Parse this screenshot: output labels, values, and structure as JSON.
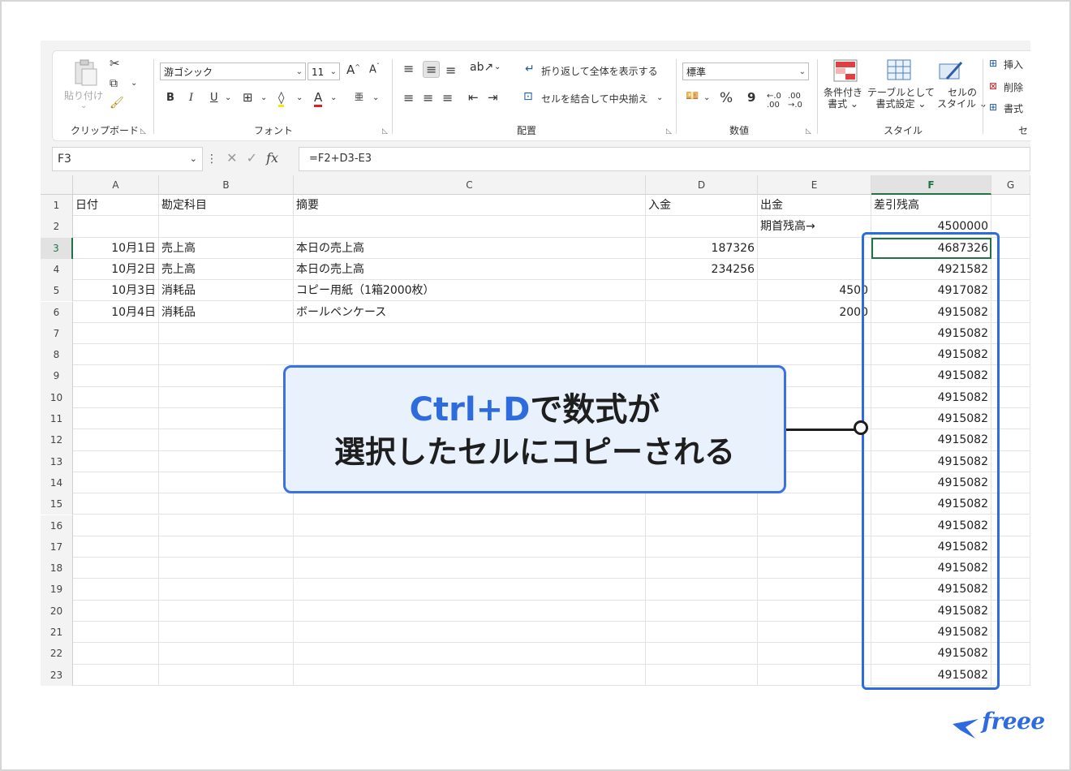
{
  "ribbon": {
    "clipboard": {
      "paste_label": "貼り付け",
      "group_label": "クリップボード"
    },
    "font": {
      "font_name": "游ゴシック",
      "font_size": "11",
      "group_label": "フォント",
      "bold": "B",
      "italic": "I",
      "underline": "U"
    },
    "alignment": {
      "wrap_text": "折り返して全体を表示する",
      "merge_center": "セルを結合して中央揃え",
      "group_label": "配置"
    },
    "number": {
      "format": "標準",
      "percent": "%",
      "comma": "9",
      "group_label": "数値"
    },
    "styles": {
      "conditional": "条件付き\n書式",
      "conditional_l1": "条件付き",
      "conditional_l2": "書式",
      "table_l1": "テーブルとして",
      "table_l2": "書式設定",
      "cell_l1": "セルの",
      "cell_l2": "スタイル",
      "group_label": "スタイル"
    },
    "cells": {
      "insert": "挿入",
      "delete": "削除",
      "format": "書式",
      "group_label": "セ"
    }
  },
  "formula_bar": {
    "name_box": "F3",
    "formula": "=F2+D3-E3",
    "fx": "fx"
  },
  "columns": [
    "A",
    "B",
    "C",
    "D",
    "E",
    "F",
    "G"
  ],
  "rows": [
    "1",
    "2",
    "3",
    "4",
    "5",
    "6",
    "7",
    "8",
    "9",
    "10",
    "11",
    "12",
    "13",
    "14",
    "15",
    "16",
    "17",
    "18",
    "19",
    "20",
    "21",
    "22",
    "23"
  ],
  "cells": {
    "A1": "日付",
    "B1": "勘定科目",
    "C1": "摘要",
    "D1": "入金",
    "E1": "出金",
    "F1": "差引残高",
    "E2": "期首残高→",
    "F2": "4500000",
    "A3": "10月1日",
    "B3": "売上高",
    "C3": "本日の売上高",
    "D3": "187326",
    "F3": "4687326",
    "A4": "10月2日",
    "B4": "売上高",
    "C4": "本日の売上高",
    "D4": "234256",
    "F4": "4921582",
    "A5": "10月3日",
    "B5": "消耗品",
    "C5": "コピー用紙（1箱2000枚）",
    "E5": "4500",
    "F5": "4917082",
    "A6": "10月4日",
    "B6": "消耗品",
    "C6": "ボールペンケース",
    "E6": "2000",
    "F6": "4915082",
    "F7": "4915082",
    "F8": "4915082",
    "F9": "4915082",
    "F10": "4915082",
    "F11": "4915082",
    "F12": "4915082",
    "F13": "4915082",
    "F14": "4915082",
    "F15": "4915082",
    "F16": "4915082",
    "F17": "4915082",
    "F18": "4915082",
    "F19": "4915082",
    "F20": "4915082",
    "F21": "4915082",
    "F22": "4915082",
    "F23": "4915082"
  },
  "callout": {
    "highlight": "Ctrl+D",
    "line1_rest": "で数式が",
    "line2": "選択したセルにコピーされる"
  },
  "logo": {
    "text": "freee"
  },
  "colors": {
    "accent": "#2f6be0",
    "excel_green": "#217346",
    "callout_bg": "#e9f1fd"
  }
}
